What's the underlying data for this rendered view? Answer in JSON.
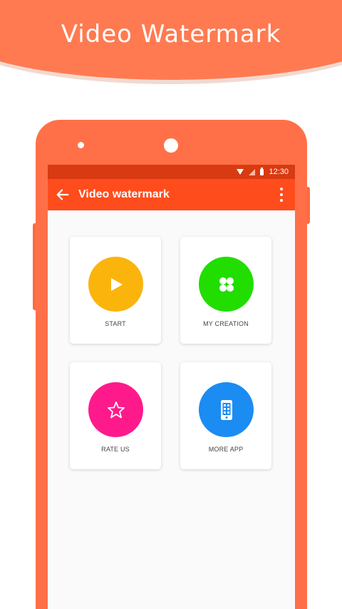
{
  "banner": {
    "title": "Video Watermark"
  },
  "status_bar": {
    "time": "12:30",
    "icons": [
      "wifi-icon",
      "signal-icon",
      "battery-icon"
    ]
  },
  "toolbar": {
    "title": "Video watermark",
    "back_icon": "arrow-left-icon",
    "menu_icon": "more-vertical-icon"
  },
  "menu": [
    {
      "label": "START",
      "icon": "play-icon",
      "color": "#fbb40c"
    },
    {
      "label": "MY CREATION",
      "icon": "grid-icon",
      "color": "#22dd00"
    },
    {
      "label": "RATE US",
      "icon": "star-icon",
      "color": "#ff1a8c"
    },
    {
      "label": "MORE APP",
      "icon": "phone-icon",
      "color": "#1b8cf2"
    }
  ],
  "colors": {
    "accent": "#ff7a50",
    "toolbar": "#ff4c1c",
    "status_bar": "#d83a12",
    "phone_body": "#ff7048"
  }
}
